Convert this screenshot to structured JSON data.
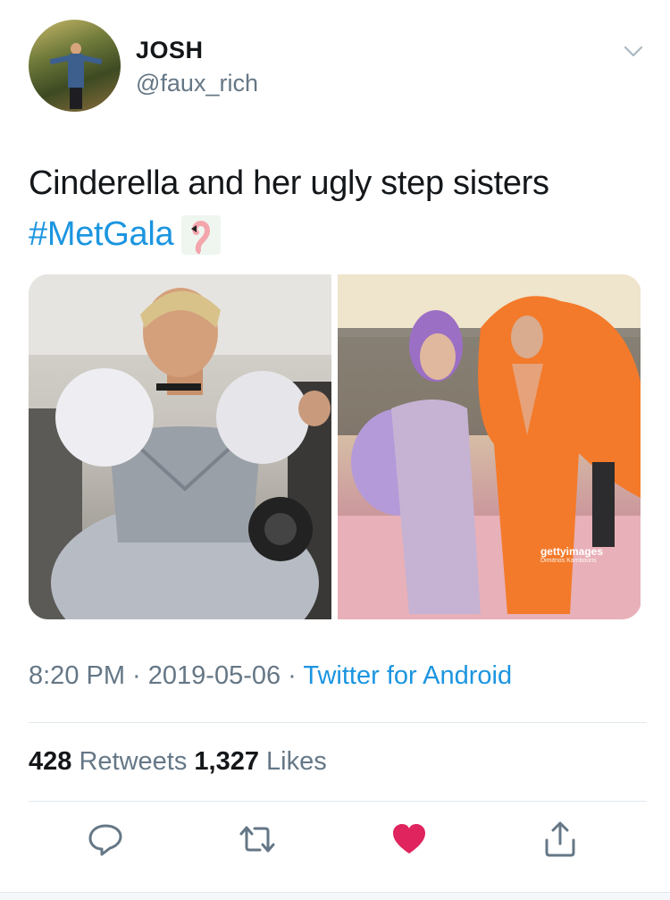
{
  "user": {
    "display_name": "JOSH",
    "handle": "@faux_rich"
  },
  "tweet": {
    "text": "Cinderella and her ugly step sisters",
    "hashtag": "#MetGala",
    "emoji": "flamingo-emoji"
  },
  "media": {
    "watermark": "gettyimages",
    "watermark_credit": "Dimitrios Kambouris"
  },
  "meta": {
    "time": "8:20 PM",
    "separator": " · ",
    "date": "2019-05-06",
    "separator2": " · ",
    "source": "Twitter for Android"
  },
  "stats": {
    "retweets_count": "428",
    "retweets_label": " Retweets ",
    "likes_count": "1,327",
    "likes_label": " Likes"
  },
  "actions": {
    "reply_icon": "reply-icon",
    "retweet_icon": "retweet-icon",
    "like_icon": "heart-icon",
    "share_icon": "share-icon"
  },
  "colors": {
    "link": "#1b95e0",
    "secondary": "#657786",
    "like": "#e0245e"
  }
}
